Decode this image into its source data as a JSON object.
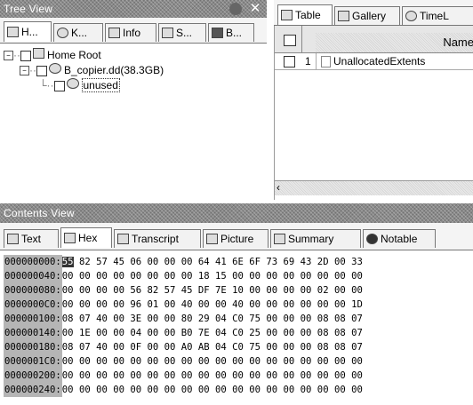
{
  "tree_view": {
    "title": "Tree View",
    "tabs": [
      "H...",
      "K...",
      "Info",
      "S...",
      "B..."
    ],
    "items": [
      {
        "label": "Home Root"
      },
      {
        "label": "B_copier.dd(38.3GB)"
      },
      {
        "label": "unused"
      }
    ]
  },
  "table_pane": {
    "tabs": [
      "Table",
      "Gallery",
      "TimeL"
    ],
    "column_header": "Name",
    "rows": [
      {
        "num": "1",
        "name": "UnallocatedExtents"
      }
    ]
  },
  "contents_view": {
    "title": "Contents View",
    "tabs": [
      "Text",
      "Hex",
      "Transcript",
      "Picture",
      "Summary",
      "Notable"
    ],
    "hex_rows": [
      {
        "offset": "000000000:",
        "first": "55",
        "bytes": "82 57 45 06 00 00 00 64 41 6E 6F 73 69 43 2D 00 33"
      },
      {
        "offset": "000000040:",
        "first": "00",
        "bytes": "00 00 00 00 00 00 00 18 15 00 00 00 00 00 00 00 00"
      },
      {
        "offset": "000000080:",
        "first": "00",
        "bytes": "00 00 00 56 82 57 45 DF 7E 10 00 00 00 00 02 00 00"
      },
      {
        "offset": "0000000C0:",
        "first": "00",
        "bytes": "00 00 00 96 01 00 40 00 00 40 00 00 00 00 00 00 1D"
      },
      {
        "offset": "000000100:",
        "first": "08",
        "bytes": "07 40 00 3E 00 00 80 29 04 C0 75 00 00 00 08 08 07"
      },
      {
        "offset": "000000140:",
        "first": "00",
        "bytes": "1E 00 00 04 00 00 B0 7E 04 C0 25 00 00 00 08 08 07"
      },
      {
        "offset": "000000180:",
        "first": "08",
        "bytes": "07 40 00 0F 00 00 A0 AB 04 C0 75 00 00 00 08 08 07"
      },
      {
        "offset": "0000001C0:",
        "first": "00",
        "bytes": "00 00 00 00 00 00 00 00 00 00 00 00 00 00 00 00 00"
      },
      {
        "offset": "000000200:",
        "first": "00",
        "bytes": "00 00 00 00 00 00 00 00 00 00 00 00 00 00 00 00 00"
      },
      {
        "offset": "000000240:",
        "first": "00",
        "bytes": "00 00 00 00 00 00 00 00 00 00 00 00 00 00 00 00 00"
      }
    ]
  }
}
